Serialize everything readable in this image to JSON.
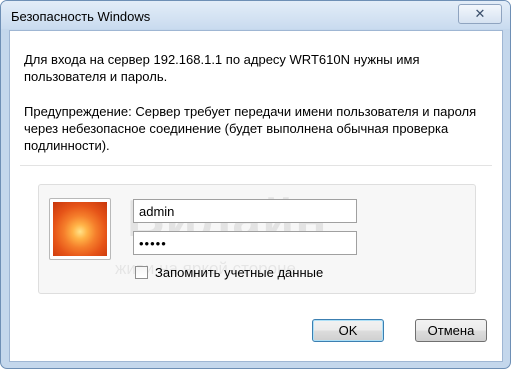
{
  "window": {
    "title": "Безопасность Windows",
    "close_symbol": "✕"
  },
  "message": {
    "line1": "Для входа на сервер 192.168.1.1 по адресу WRT610N нужны имя пользователя и пароль.",
    "warning": "Предупреждение: Сервер требует передачи имени пользователя и пароля через небезопасное соединение (будет выполнена обычная проверка подлинности)."
  },
  "credentials": {
    "username": "admin",
    "password": "•••••",
    "remember_label": "Запомнить учетные данные",
    "remember_checked": false
  },
  "watermark": {
    "brand": "Билайн",
    "tagline": "живи на яркой стороне"
  },
  "buttons": {
    "ok": "OK",
    "cancel": "Отмена"
  }
}
